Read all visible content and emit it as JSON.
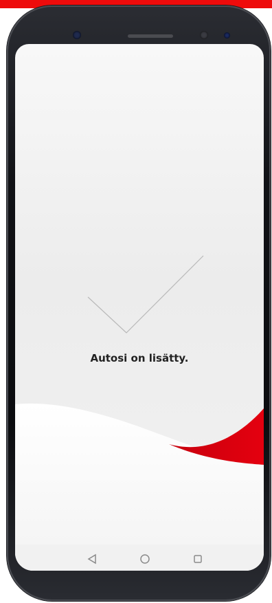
{
  "app": {
    "message": "Autosi on lisätty."
  },
  "colors": {
    "accent_red": "#e4000f",
    "top_strip": "#ee0b0b",
    "phone_frame": "#111216",
    "screen_background": "#efefef",
    "text": "#222222"
  },
  "icons": {
    "success": "checkmark-icon",
    "nav_back": "back-triangle-icon",
    "nav_home": "home-circle-icon",
    "nav_recents": "recents-square-icon"
  }
}
